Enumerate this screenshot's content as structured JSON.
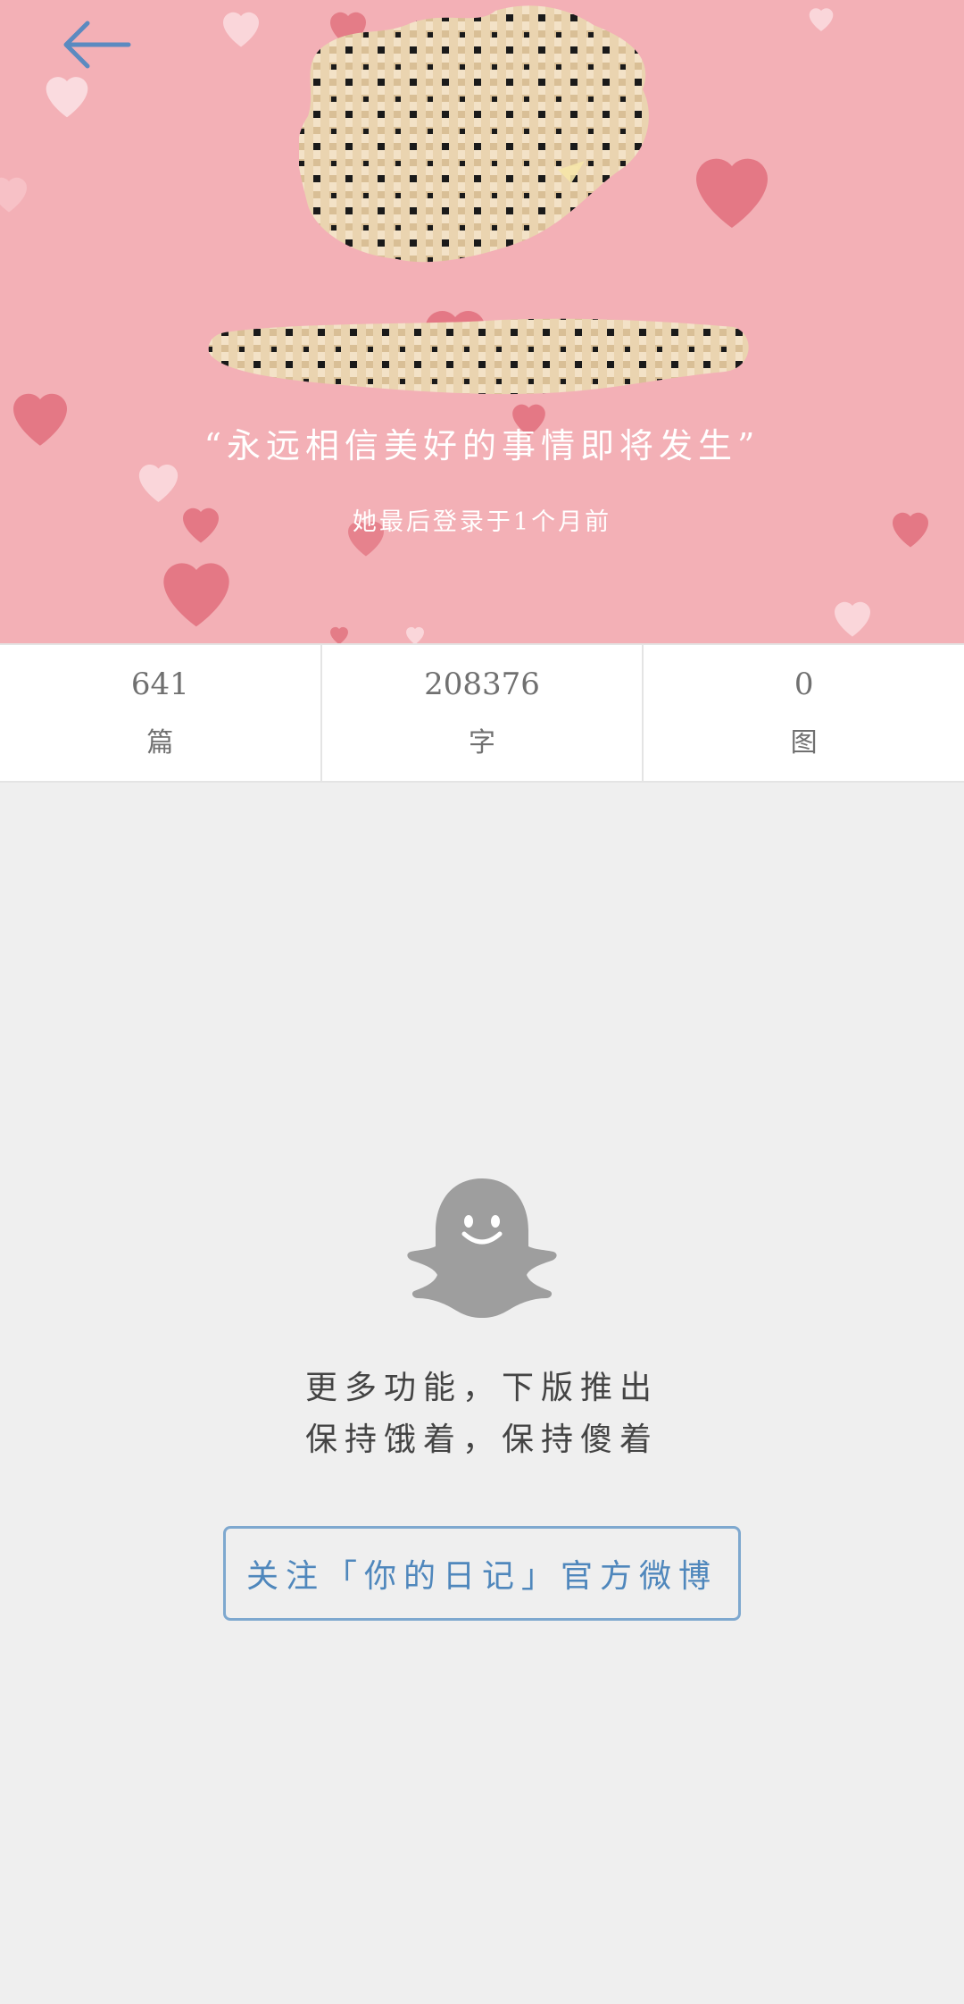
{
  "profile": {
    "motto": "“永远相信美好的事情即将发生”",
    "last_login": "她最后登录于1个月前"
  },
  "stats": [
    {
      "value": "641",
      "label": "篇"
    },
    {
      "value": "208376",
      "label": "字"
    },
    {
      "value": "0",
      "label": "图"
    }
  ],
  "empty_state": {
    "line1": "更多功能，下版推出",
    "line2": "保持饿着，保持傻着"
  },
  "follow_button": {
    "label": "关注「你的日记」官方微博"
  },
  "icons": {
    "back": "arrow-left-icon",
    "ghost": "ghost-icon"
  },
  "colors": {
    "header_bg": "#f3b0b6",
    "accent": "#4f87bc",
    "page_bg": "#efefef"
  }
}
